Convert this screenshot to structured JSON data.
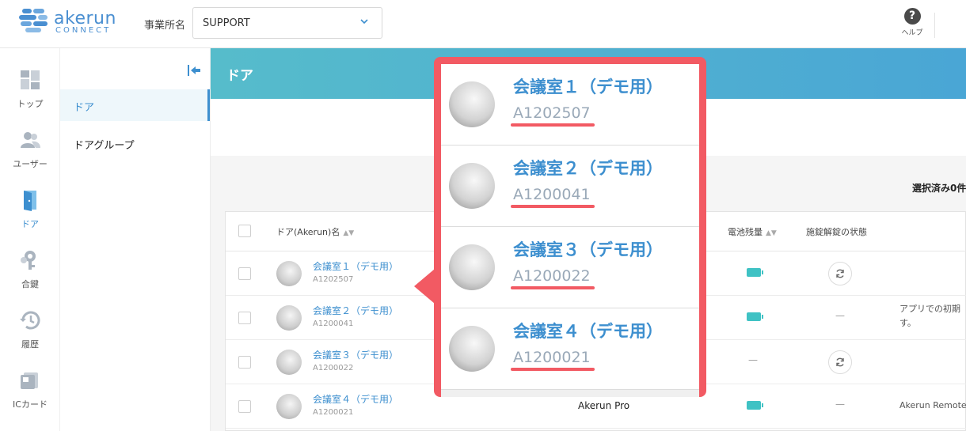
{
  "header": {
    "logo_word": "akerun",
    "logo_sub": "CONNECT",
    "office_label": "事業所名",
    "office_value": "SUPPORT",
    "help_label": "ヘルプ",
    "help_glyph": "?"
  },
  "leftnav": {
    "items": [
      {
        "label": "トップ",
        "icon": "dashboard-icon"
      },
      {
        "label": "ユーザー",
        "icon": "users-icon"
      },
      {
        "label": "ドア",
        "icon": "door-icon",
        "active": true
      },
      {
        "label": "合鍵",
        "icon": "key-icon"
      },
      {
        "label": "履歴",
        "icon": "history-icon"
      },
      {
        "label": "ICカード",
        "icon": "ic-card-icon"
      }
    ]
  },
  "subnav": {
    "items": [
      {
        "label": "ドア",
        "active": true
      },
      {
        "label": "ドアグループ"
      }
    ]
  },
  "main": {
    "title": "ドア",
    "selected_count": "選択済み0件"
  },
  "table": {
    "headers": {
      "name": "ドア(Akerun)名",
      "battery": "電池残量",
      "lock_state": "施錠解錠の状態"
    },
    "rows": [
      {
        "name": "会議室１（デモ用）",
        "code": "A1202507",
        "model": "",
        "battery": "full",
        "state": "sync",
        "note": ""
      },
      {
        "name": "会議室２（デモ用）",
        "code": "A1200041",
        "model": "",
        "battery": "full",
        "state": "—",
        "note1": "アプリでの初期",
        "note2": "す。"
      },
      {
        "name": "会議室３（デモ用）",
        "code": "A1200022",
        "model": "",
        "battery": "—",
        "state": "sync",
        "note": ""
      },
      {
        "name": "会議室４（デモ用）",
        "code": "A1200021",
        "model": "Akerun Pro",
        "battery": "full",
        "state": "—",
        "note": "Akerun Remote"
      }
    ]
  },
  "callout": {
    "items": [
      {
        "name": "会議室１（デモ用）",
        "code": "A1202507"
      },
      {
        "name": "会議室２（デモ用）",
        "code": "A1200041"
      },
      {
        "name": "会議室３（デモ用）",
        "code": "A1200022"
      },
      {
        "name": "会議室４（デモ用）",
        "code": "A1200021"
      }
    ]
  },
  "colors": {
    "accent": "#3d8fcf",
    "highlight": "#f25a63",
    "battery": "#3fc2c4"
  }
}
